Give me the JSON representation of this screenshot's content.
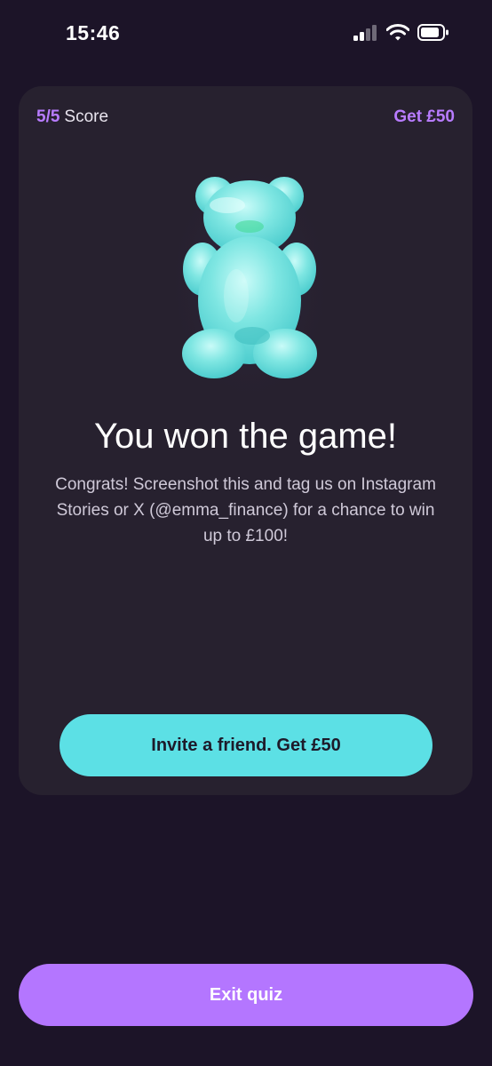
{
  "status_bar": {
    "time": "15:46",
    "icons": [
      "cellular-signal-icon",
      "wifi-icon",
      "battery-icon"
    ]
  },
  "card": {
    "score_value": "5/5",
    "score_label": "Score",
    "reward": "Get £50",
    "image": "gummy-bear-icon",
    "title": "You won the game!",
    "description": "Congrats! Screenshot this and tag us on Instagram Stories or X (@emma_finance) for a chance to win up to £100!",
    "invite_button": "Invite a friend. Get £50"
  },
  "exit_button": "Exit quiz",
  "colors": {
    "background": "#1c1428",
    "card": "#27212f",
    "accent_purple": "#b87cff",
    "accent_teal": "#5ce0e5",
    "exit_button": "#b476ff"
  }
}
